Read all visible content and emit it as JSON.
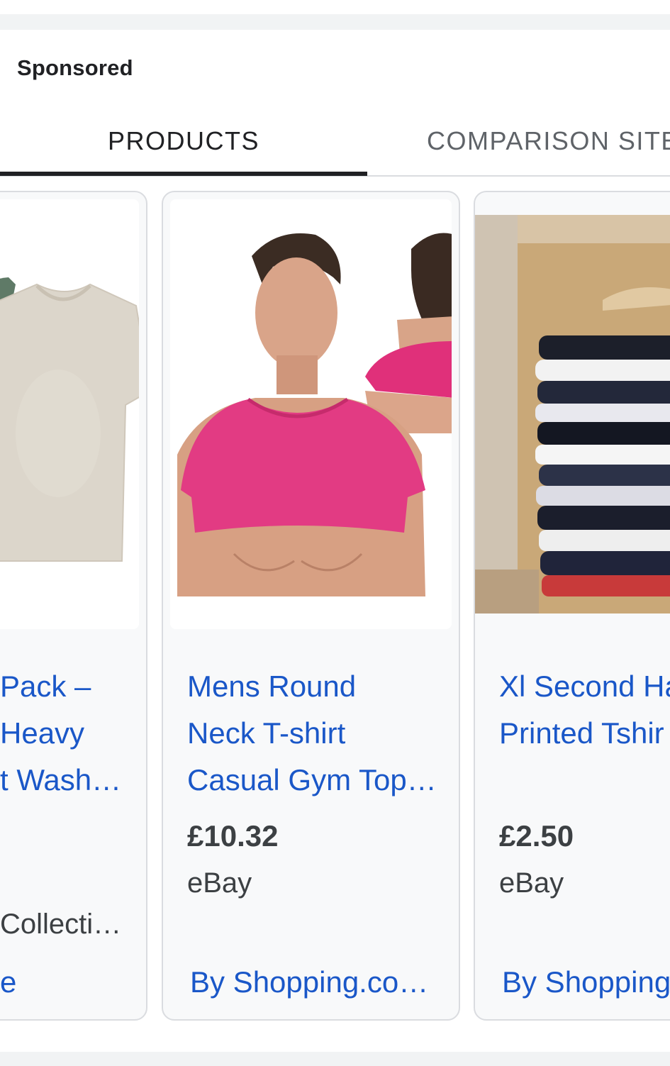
{
  "section": {
    "sponsored_label": "Sponsored"
  },
  "tabs": [
    {
      "label": "PRODUCTS",
      "active": true
    },
    {
      "label": "COMPARISON SITES",
      "active": false
    }
  ],
  "cards": [
    {
      "title_lines": [
        "Pack –",
        "Heavy",
        "t Wash…"
      ],
      "seller": "Collecti…",
      "link": "e",
      "image": "beige-tshirt-photo"
    },
    {
      "title_lines": [
        "Mens Round",
        "Neck T-shirt",
        "Casual Gym Top…"
      ],
      "price": "£10.32",
      "seller": "eBay",
      "link": "By Shopping.co…",
      "image": "pink-crop-top-photo"
    },
    {
      "title_lines": [
        "Xl Second Ha",
        "Printed Tshir"
      ],
      "price": "£2.50",
      "seller": "eBay",
      "link": "By Shopping",
      "image": "tshirt-stack-photo"
    }
  ],
  "colors": {
    "link_blue": "#1a57c8",
    "text_dark": "#202124",
    "card_bg": "#f8f9fa",
    "border": "#dadce0"
  }
}
